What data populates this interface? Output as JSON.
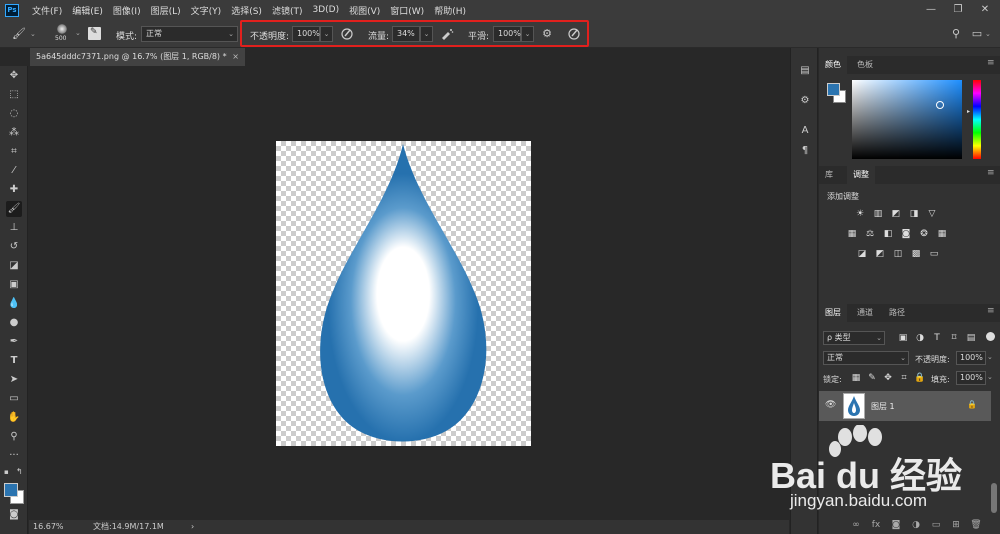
{
  "app": {
    "logo": "Ps"
  },
  "menu": [
    "文件(F)",
    "编辑(E)",
    "图像(I)",
    "图层(L)",
    "文字(Y)",
    "选择(S)",
    "滤镜(T)",
    "3D(D)",
    "视图(V)",
    "窗口(W)",
    "帮助(H)"
  ],
  "window_controls": {
    "minimize": "—",
    "restore": "❐",
    "close": "✕"
  },
  "options": {
    "brush_size": "500",
    "mode_label": "模式:",
    "mode_value": "正常",
    "opacity_label": "不透明度:",
    "opacity_value": "100%",
    "flow_label": "流量:",
    "flow_value": "34%",
    "smoothing_label": "平滑:",
    "smoothing_value": "100%"
  },
  "document_tab": {
    "title": "5a645dddc7371.png @ 16.7% (图层 1, RGB/8) *",
    "close": "×"
  },
  "status": {
    "zoom": "16.67%",
    "doc_info": "文档:14.9M/17.1M",
    "arrow": "›"
  },
  "color_panel": {
    "tabs": [
      "颜色",
      "色板"
    ],
    "foreground": "#2b74b0",
    "background": "#ffffff"
  },
  "adjust_panel": {
    "tabs": [
      "库",
      "调整"
    ],
    "title": "添加调整"
  },
  "layers_panel": {
    "tabs": [
      "图层",
      "通道",
      "路径"
    ],
    "filter_label": "ρ 类型",
    "blend_mode": "正常",
    "opacity_label": "不透明度:",
    "opacity_value": "100%",
    "lock_label": "锁定:",
    "fill_label": "填充:",
    "fill_value": "100%",
    "layers": [
      {
        "name": "图层 1",
        "visible": true,
        "locked": true
      }
    ]
  },
  "watermark": {
    "brand": "Bai du 经验",
    "url": "jingyan.baidu.com"
  },
  "colors": {
    "accent": "#31a8ff",
    "highlight_box": "#e1201d",
    "drop_blue": "#2b74b0"
  }
}
